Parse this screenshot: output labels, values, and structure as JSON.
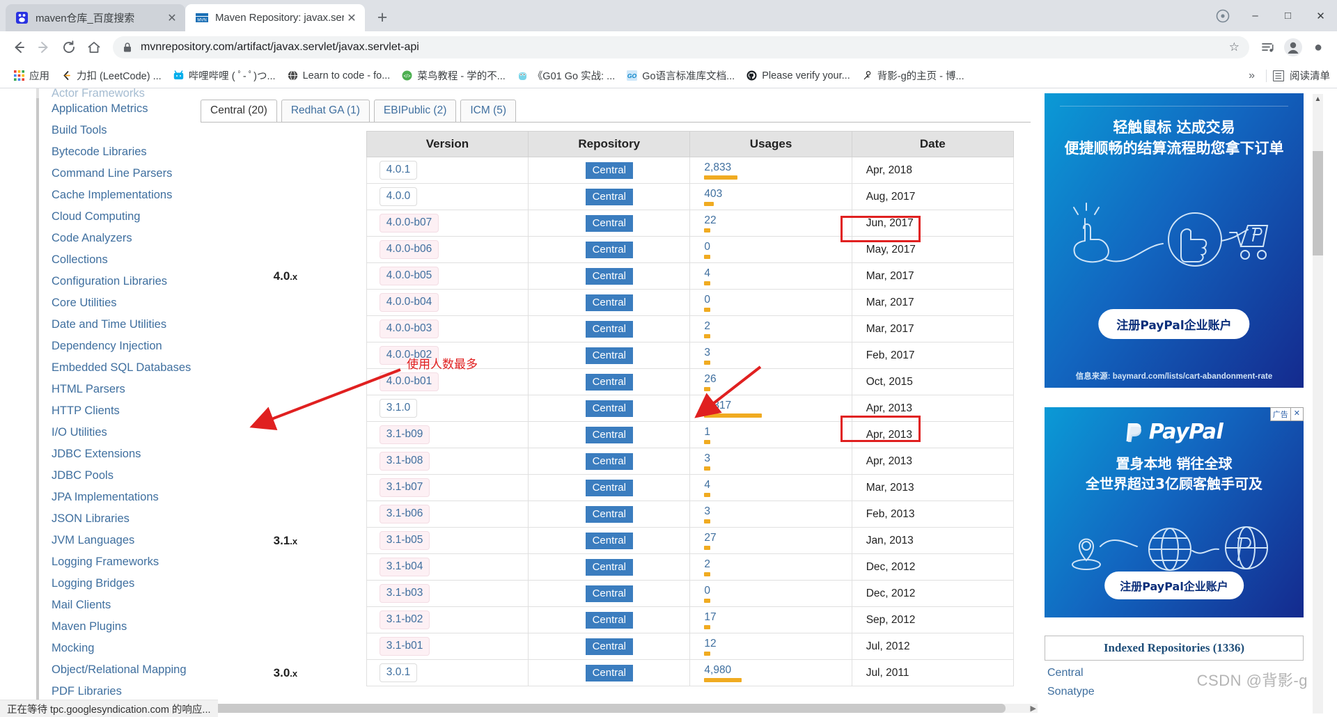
{
  "browser": {
    "tabs": [
      {
        "title": "maven仓库_百度搜索",
        "favicon": "baidu-icon",
        "active": false,
        "close_label": "✕"
      },
      {
        "title": "Maven Repository: javax.servle",
        "favicon": "mvn-icon",
        "active": true,
        "close_label": "✕"
      }
    ],
    "new_tab_label": "+",
    "window_controls": {
      "minimize": "–",
      "maximize": "□",
      "close": "✕",
      "extra": "●"
    },
    "nav": {
      "back": "←",
      "forward": "→",
      "reload": "↻",
      "home": "⌂"
    },
    "omnibox": {
      "url": "mvnrepository.com/artifact/javax.servlet/javax.servlet-api",
      "lock_icon": "lock-icon",
      "star_icon": "☆"
    },
    "toolbar_right": {
      "reading_list": "reading-list-icon",
      "profile": "profile-avatar-icon",
      "menu": "⋮"
    },
    "bookmarks": [
      {
        "label": "应用",
        "icon": "apps-grid-icon"
      },
      {
        "label": "力扣 (LeetCode) ...",
        "icon": "leetcode-icon"
      },
      {
        "label": "哔哩哔哩 ( ﾟ- ﾟ)つ...",
        "icon": "bilibili-icon"
      },
      {
        "label": "Learn to code - fo...",
        "icon": "globe-icon"
      },
      {
        "label": "菜鸟教程 - 学的不...",
        "icon": "runoob-icon"
      },
      {
        "label": "《G01 Go 实战: ...",
        "icon": "gopher-icon"
      },
      {
        "label": "Go语言标准库文档...",
        "icon": "go-icon"
      },
      {
        "label": "Please verify your...",
        "icon": "github-icon"
      },
      {
        "label": "背影-g的主页 - 博...",
        "icon": "person-icon"
      }
    ],
    "bookmarks_overflow": "»",
    "reading_list_label": "阅读清单",
    "reading_list_icon": "list-icon",
    "status_text": "正在等待 tpc.googlesyndication.com 的响应..."
  },
  "sidebar": {
    "clipped_top_item": "Actor Frameworks",
    "items": [
      "Application Metrics",
      "Build Tools",
      "Bytecode Libraries",
      "Command Line Parsers",
      "Cache Implementations",
      "Cloud Computing",
      "Code Analyzers",
      "Collections",
      "Configuration Libraries",
      "Core Utilities",
      "Date and Time Utilities",
      "Dependency Injection",
      "Embedded SQL Databases",
      "HTML Parsers",
      "HTTP Clients",
      "I/O Utilities",
      "JDBC Extensions",
      "JDBC Pools",
      "JPA Implementations",
      "JSON Libraries",
      "JVM Languages",
      "Logging Frameworks",
      "Logging Bridges",
      "Mail Clients",
      "Maven Plugins",
      "Mocking",
      "Object/Relational Mapping",
      "PDF Libraries"
    ]
  },
  "main": {
    "repo_tabs": [
      {
        "label": "Central (20)",
        "selected": true
      },
      {
        "label": "Redhat GA (1)",
        "selected": false
      },
      {
        "label": "EBIPublic (2)",
        "selected": false
      },
      {
        "label": "ICM (5)",
        "selected": false
      }
    ],
    "table": {
      "headers": [
        "Version",
        "Repository",
        "Usages",
        "Date"
      ],
      "rows": [
        {
          "group": "",
          "version": "4.0.1",
          "beta": false,
          "repo": "Central",
          "usages": "2,833",
          "bar": 48,
          "date": "Apr, 2018"
        },
        {
          "group": "",
          "version": "4.0.0",
          "beta": false,
          "repo": "Central",
          "usages": "403",
          "bar": 14,
          "date": "Aug, 2017"
        },
        {
          "group": "",
          "version": "4.0.0-b07",
          "beta": true,
          "repo": "Central",
          "usages": "22",
          "bar": 9,
          "date": "Jun, 2017"
        },
        {
          "group": "",
          "version": "4.0.0-b06",
          "beta": true,
          "repo": "Central",
          "usages": "0",
          "bar": 9,
          "date": "May, 2017"
        },
        {
          "group": "4.0",
          "version": "4.0.0-b05",
          "beta": true,
          "repo": "Central",
          "usages": "4",
          "bar": 9,
          "date": "Mar, 2017"
        },
        {
          "group": "",
          "version": "4.0.0-b04",
          "beta": true,
          "repo": "Central",
          "usages": "0",
          "bar": 9,
          "date": "Mar, 2017"
        },
        {
          "group": "",
          "version": "4.0.0-b03",
          "beta": true,
          "repo": "Central",
          "usages": "2",
          "bar": 9,
          "date": "Mar, 2017"
        },
        {
          "group": "",
          "version": "4.0.0-b02",
          "beta": true,
          "repo": "Central",
          "usages": "3",
          "bar": 9,
          "date": "Feb, 2017"
        },
        {
          "group": "",
          "version": "4.0.0-b01",
          "beta": true,
          "repo": "Central",
          "usages": "26",
          "bar": 9,
          "date": "Oct, 2015"
        },
        {
          "group": "",
          "version": "3.1.0",
          "beta": false,
          "repo": "Central",
          "usages": "8,317",
          "bar": 83,
          "date": "Apr, 2013"
        },
        {
          "group": "",
          "version": "3.1-b09",
          "beta": true,
          "repo": "Central",
          "usages": "1",
          "bar": 9,
          "date": "Apr, 2013"
        },
        {
          "group": "",
          "version": "3.1-b08",
          "beta": true,
          "repo": "Central",
          "usages": "3",
          "bar": 9,
          "date": "Apr, 2013"
        },
        {
          "group": "",
          "version": "3.1-b07",
          "beta": true,
          "repo": "Central",
          "usages": "4",
          "bar": 9,
          "date": "Mar, 2013"
        },
        {
          "group": "",
          "version": "3.1-b06",
          "beta": true,
          "repo": "Central",
          "usages": "3",
          "bar": 9,
          "date": "Feb, 2013"
        },
        {
          "group": "3.1",
          "version": "3.1-b05",
          "beta": true,
          "repo": "Central",
          "usages": "27",
          "bar": 9,
          "date": "Jan, 2013"
        },
        {
          "group": "",
          "version": "3.1-b04",
          "beta": true,
          "repo": "Central",
          "usages": "2",
          "bar": 9,
          "date": "Dec, 2012"
        },
        {
          "group": "",
          "version": "3.1-b03",
          "beta": true,
          "repo": "Central",
          "usages": "0",
          "bar": 9,
          "date": "Dec, 2012"
        },
        {
          "group": "",
          "version": "3.1-b02",
          "beta": true,
          "repo": "Central",
          "usages": "17",
          "bar": 9,
          "date": "Sep, 2012"
        },
        {
          "group": "",
          "version": "3.1-b01",
          "beta": true,
          "repo": "Central",
          "usages": "12",
          "bar": 9,
          "date": "Jul, 2012"
        },
        {
          "group": "3.0",
          "version": "3.0.1",
          "beta": false,
          "repo": "Central",
          "usages": "4,980",
          "bar": 54,
          "date": "Jul, 2011"
        }
      ],
      "group_suffix": ".x"
    },
    "annotation": {
      "text": "使用人数最多",
      "color": "#e02020",
      "highlight_rows": [
        "4.0.1",
        "3.1.0"
      ]
    }
  },
  "rail": {
    "ad1": {
      "title_line1": "轻触鼠标 达成交易",
      "title_line2": "便捷顺畅的结算流程助您拿下订单",
      "cta": "注册PayPal企业账户",
      "source": "信息来源: baymard.com/lists/cart-abandonment-rate"
    },
    "ad2": {
      "brand": "PayPal",
      "title_line1": "置身本地 销往全球",
      "title_line2": "全世界超过3亿顾客触手可及",
      "cta": "注册PayPal企业账户",
      "ad_label": "广告",
      "close_label": "✕"
    },
    "repositories": {
      "header": "Indexed Repositories (1336)",
      "links": [
        "Central",
        "Sonatype"
      ]
    },
    "watermark": "CSDN @背影-g"
  },
  "colors": {
    "accent_blue": "#3f6f9f",
    "repo_badge": "#3b7dbf",
    "usage_bar": "#f0ab21",
    "annotation_red": "#e02020",
    "tab_active_bg": "#ffffff",
    "toolbar_bg": "#ffffff"
  }
}
